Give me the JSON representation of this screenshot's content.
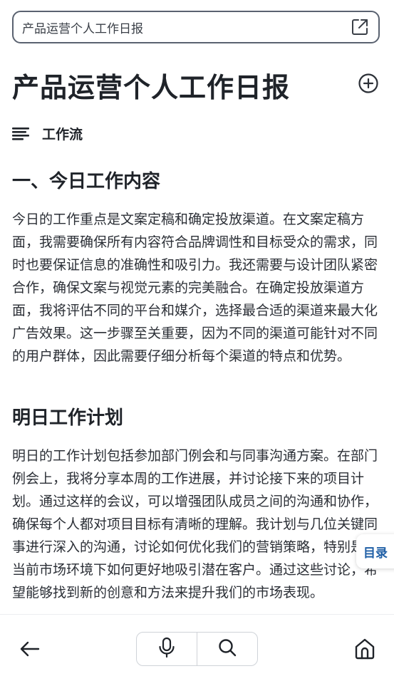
{
  "search_bar": {
    "text": "产品运营个人工作日报",
    "icon": "external-link-icon"
  },
  "document": {
    "title": "产品运营个人工作日报",
    "workflow_label": "工作流",
    "sections": [
      {
        "heading": "一、今日工作内容",
        "body": "今日的工作重点是文案定稿和确定投放渠道。在文案定稿方面，我需要确保所有内容符合品牌调性和目标受众的需求，同时也要保证信息的准确性和吸引力。我还需要与设计团队紧密合作，确保文案与视觉元素的完美融合。在确定投放渠道方面，我将评估不同的平台和媒介，选择最合适的渠道来最大化广告效果。这一步骤至关重要，因为不同的渠道可能针对不同的用户群体，因此需要仔细分析每个渠道的特点和优势。"
      },
      {
        "heading": "明日工作计划",
        "body": "明日的工作计划包括参加部门例会和与同事沟通方案。在部门例会上，我将分享本周的工作进展，并讨论接下来的项目计划。通过这样的会议，可以增强团队成员之间的沟通和协作，确保每个人都对项目目标有清晰的理解。我计划与几位关键同事进行深入的沟通，讨论如何优化我们的营销策略，特别是在当前市场环境下如何更好地吸引潜在客户。通过这些讨论，希望能够找到新的创意和方法来提升我们的市场表现。"
      }
    ]
  },
  "toc_tab": {
    "label": "目录"
  },
  "bottom_bar": {
    "icons": [
      "back-arrow-icon",
      "microphone-icon",
      "search-icon",
      "home-icon"
    ]
  },
  "colors": {
    "text": "#1f2329",
    "toc_accent": "#1f5fa6",
    "border": "#5a6270"
  }
}
